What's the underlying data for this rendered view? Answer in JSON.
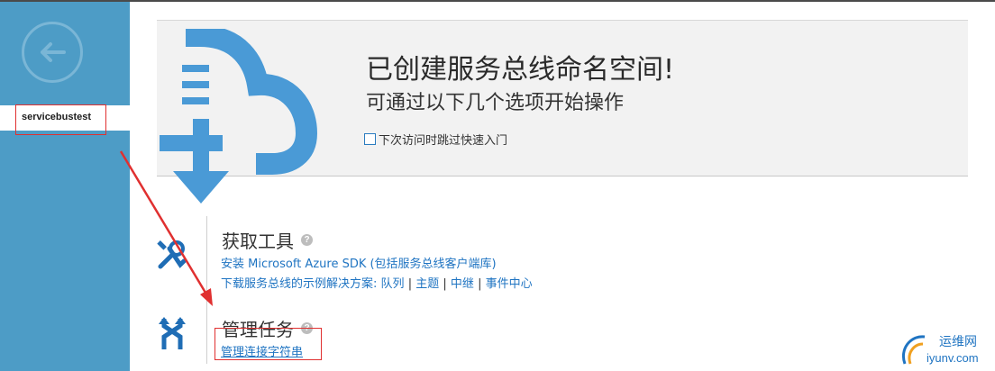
{
  "sidebar": {
    "back_icon": "back-arrow-icon",
    "selected_item": "servicebustest"
  },
  "banner": {
    "title": "已创建服务总线命名空间!",
    "subtitle": "可通过以下几个选项开始操作",
    "skip_label": "下次访问时跳过快速入门",
    "skip_checked": false,
    "illustration_icon": "cloud-download-icon"
  },
  "get_tools": {
    "icon": "tools-icon",
    "title": "获取工具",
    "install_sdk": "安装 Microsoft Azure SDK (包括服务总线客户端库)",
    "download_samples_prefix": "下载服务总线的示例解决方案:",
    "samples": [
      "队列",
      "主题",
      "中继",
      "事件中心"
    ],
    "separator": "|"
  },
  "manage_tasks": {
    "icon": "arrows-exchange-icon",
    "title": "管理任务",
    "connection_string": "管理连接字符串"
  },
  "watermark": {
    "line1": "运维网",
    "line2": "iyunv.com"
  },
  "colors": {
    "sidebar": "#4d9cc6",
    "accent_blue": "#3d8fd4",
    "link": "#1f74c2",
    "annotation_red": "#e03030"
  }
}
